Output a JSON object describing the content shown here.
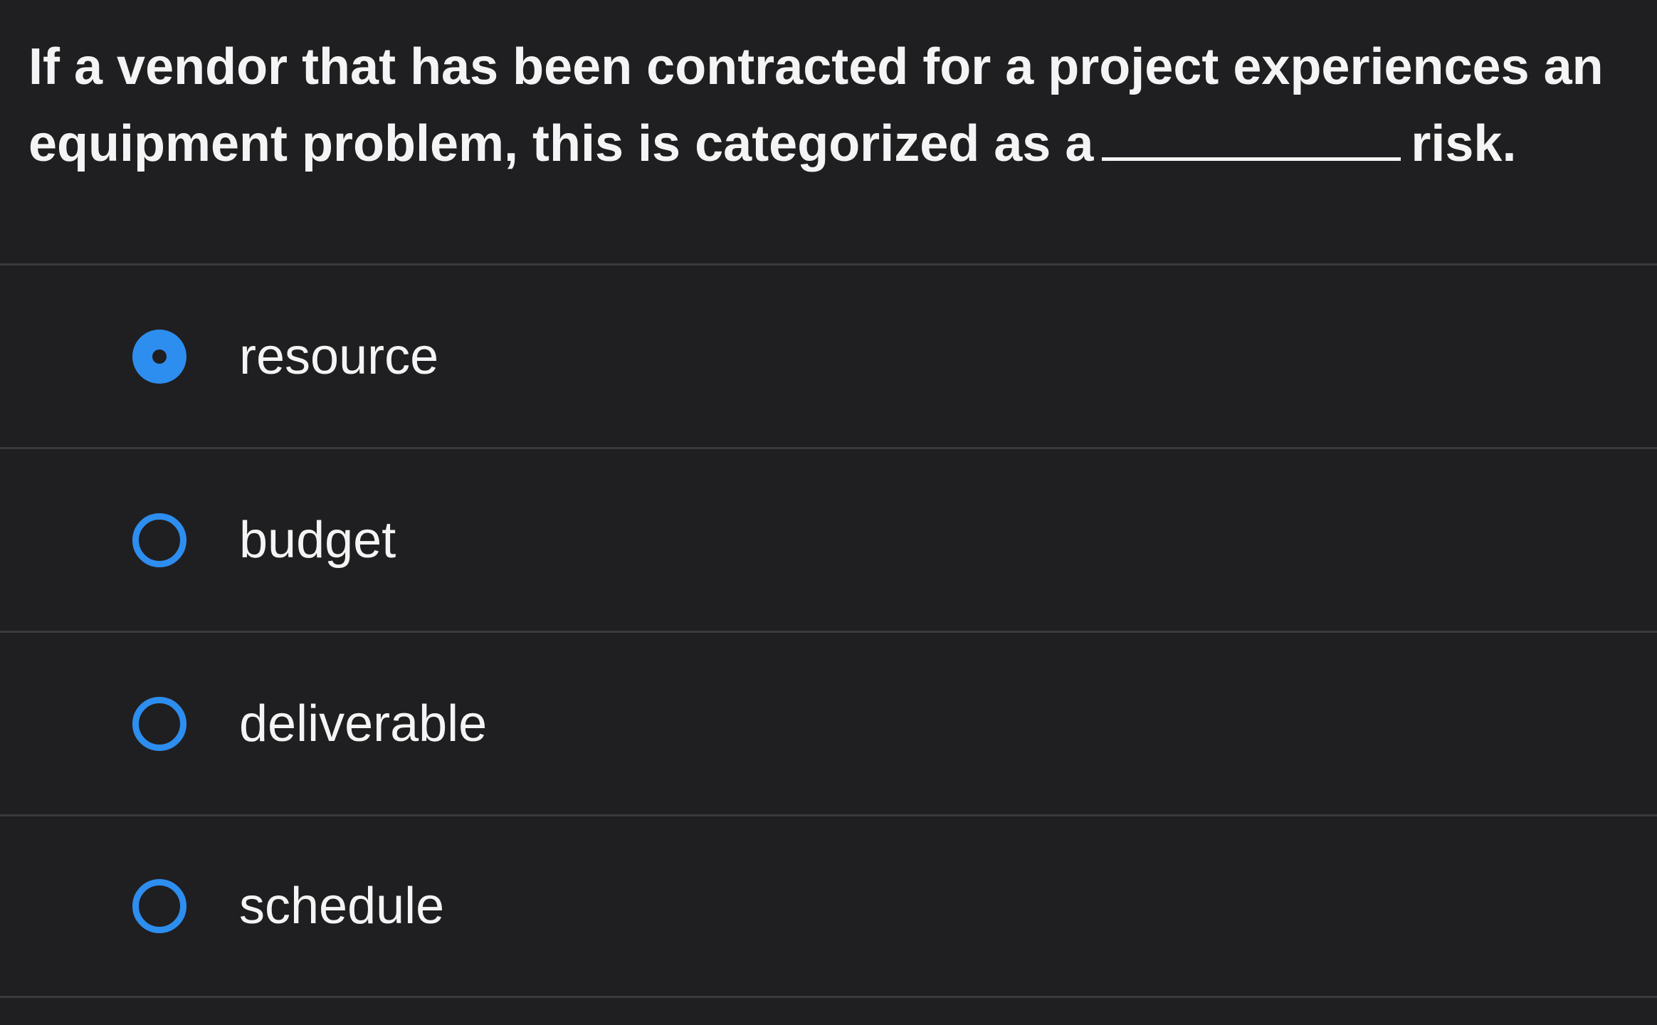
{
  "question": {
    "text_before_blank": "If a vendor that has been contracted for a project experiences an equipment problem, this is categorized as a",
    "text_after_blank": "risk."
  },
  "options": [
    {
      "label": "resource",
      "selected": true
    },
    {
      "label": "budget",
      "selected": false
    },
    {
      "label": "deliverable",
      "selected": false
    },
    {
      "label": "schedule",
      "selected": false
    }
  ],
  "colors": {
    "accent": "#2e8ef0",
    "background": "#1f1f21",
    "text": "#f4f4f4"
  }
}
